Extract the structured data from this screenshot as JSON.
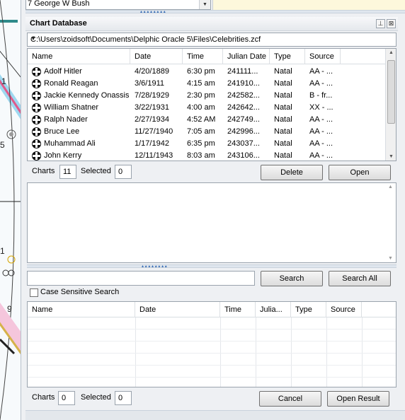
{
  "top": {
    "dropdown_value": "7 George W Bush"
  },
  "panel": {
    "title": "Chart Database",
    "pin_glyph": "⊥",
    "close_glyph": "⊠",
    "path": "C:\\Users\\zoidsoft\\Documents\\Delphic Oracle 5\\Files\\Celebrities.zcf"
  },
  "wheel": {
    "labels": [
      "1",
      "5",
      "1",
      "9"
    ]
  },
  "table": {
    "columns": [
      "Name",
      "Date",
      "Time",
      "Julian Date",
      "Type",
      "Source"
    ],
    "rows": [
      {
        "name": "Adolf Hitler",
        "date": "4/20/1889",
        "time": "6:30 pm",
        "julian": "241111...",
        "type": "Natal",
        "source": "AA - ..."
      },
      {
        "name": "Ronald Reagan",
        "date": "3/6/1911",
        "time": "4:15 am",
        "julian": "241910...",
        "type": "Natal",
        "source": "AA - ..."
      },
      {
        "name": "Jackie Kennedy Onassis",
        "date": "7/28/1929",
        "time": "2:30 pm",
        "julian": "242582...",
        "type": "Natal",
        "source": "B - fr..."
      },
      {
        "name": "William Shatner",
        "date": "3/22/1931",
        "time": "4:00 am",
        "julian": "242642...",
        "type": "Natal",
        "source": "XX - ..."
      },
      {
        "name": "Ralph Nader",
        "date": "2/27/1934",
        "time": "4:52 AM",
        "julian": "242749...",
        "type": "Natal",
        "source": "AA - ..."
      },
      {
        "name": "Bruce Lee",
        "date": "11/27/1940",
        "time": "7:05 am",
        "julian": "242996...",
        "type": "Natal",
        "source": "AA - ..."
      },
      {
        "name": "Muhammad Ali",
        "date": "1/17/1942",
        "time": "6:35 pm",
        "julian": "243037...",
        "type": "Natal",
        "source": "AA - ..."
      },
      {
        "name": "John Kerry",
        "date": "12/11/1943",
        "time": "8:03 am",
        "julian": "243106...",
        "type": "Natal",
        "source": "AA - ..."
      }
    ]
  },
  "footer1": {
    "charts_label": "Charts",
    "charts_count": "11",
    "selected_label": "Selected",
    "selected_count": "0",
    "delete_label": "Delete",
    "open_label": "Open"
  },
  "search": {
    "value": "",
    "search_label": "Search",
    "search_all_label": "Search All",
    "case_sensitive_label": "Case Sensitive Search"
  },
  "results": {
    "columns": [
      "Name",
      "Date",
      "Time",
      "Julia...",
      "Type",
      "Source"
    ]
  },
  "footer2": {
    "charts_label": "Charts",
    "charts_count": "0",
    "selected_label": "Selected",
    "selected_count": "0",
    "cancel_label": "Cancel",
    "open_result_label": "Open Result"
  }
}
